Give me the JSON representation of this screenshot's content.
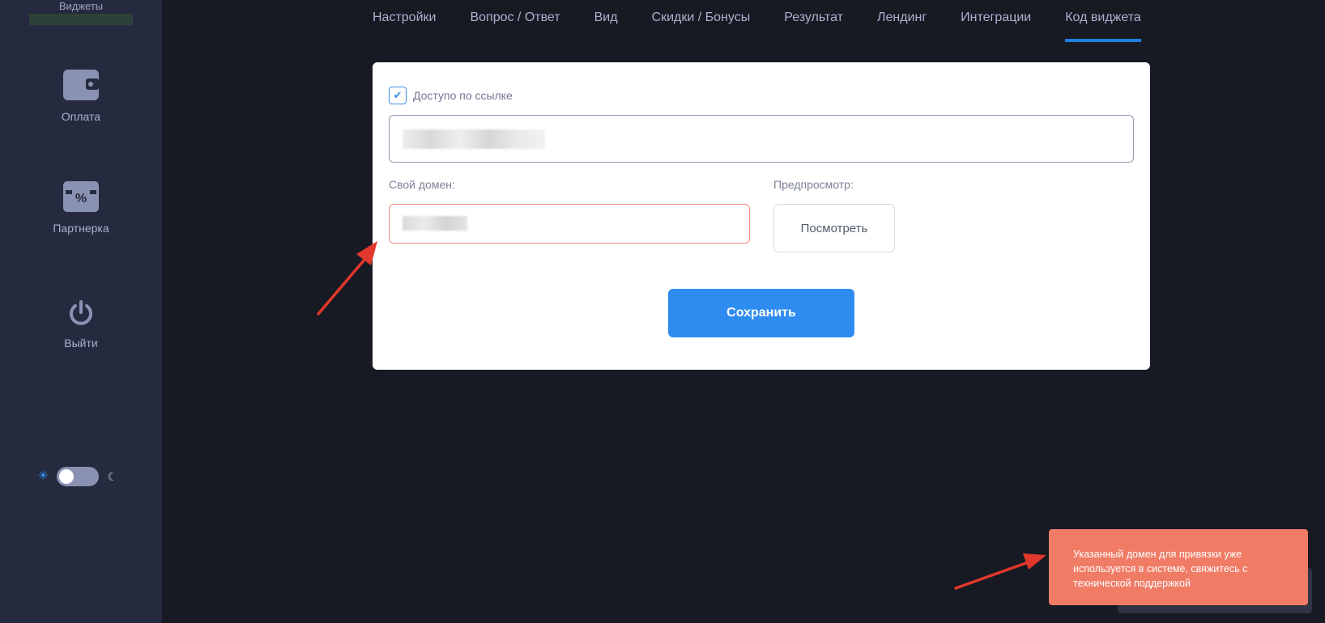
{
  "sidebar": {
    "top_label": "Виджеты",
    "items": [
      {
        "label": "Оплата",
        "icon": "wallet-icon"
      },
      {
        "label": "Партнерка",
        "icon": "percent-ticket-icon"
      },
      {
        "label": "Выйти",
        "icon": "power-icon"
      }
    ],
    "theme": {
      "light_icon": "sun-icon",
      "dark_icon": "moon-icon",
      "state": "light"
    }
  },
  "tabs": [
    {
      "label": "Настройки"
    },
    {
      "label": "Вопрос / Ответ"
    },
    {
      "label": "Вид"
    },
    {
      "label": "Скидки / Бонусы"
    },
    {
      "label": "Результат"
    },
    {
      "label": "Лендинг"
    },
    {
      "label": "Интеграции"
    },
    {
      "label": "Код виджета",
      "active": true
    }
  ],
  "form": {
    "link_access_label": "Доступо по ссылке",
    "link_access_checked": true,
    "custom_domain_label": "Свой домен:",
    "preview_label": "Предпросмотр:",
    "preview_button": "Посмотреть",
    "save_button": "Сохранить"
  },
  "toast": {
    "message": "Указанный домен для привязки уже используется в системе, свяжитесь с технической поддержкой"
  },
  "colors": {
    "page_bg": "#171923",
    "sidebar_bg": "#262a3e",
    "accent": "#2e8cf0",
    "error_border": "#f08a82",
    "toast_bg": "#f07c66",
    "annotation_arrow": "#e0382b"
  }
}
